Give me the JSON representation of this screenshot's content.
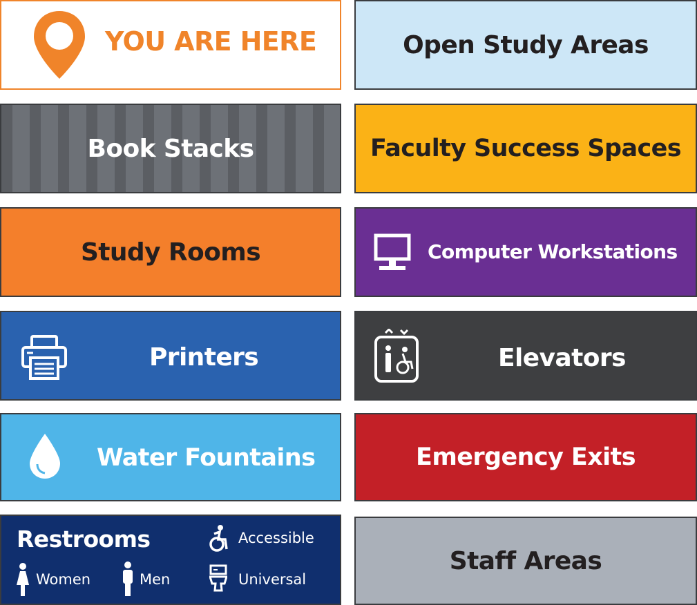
{
  "legend": {
    "you_are_here": {
      "label": "YOU ARE HERE",
      "icon": "location-pin-icon",
      "color": "#F0842A",
      "bg": "#ffffff"
    },
    "open_study_areas": {
      "label": "Open Study Areas",
      "color": "#CDE7F7"
    },
    "book_stacks": {
      "label": "Book Stacks",
      "color": "#5B5E63",
      "stripe_color": "#6D7177"
    },
    "faculty_success_spaces": {
      "label": "Faculty Success Spaces",
      "color": "#FBB216"
    },
    "study_rooms": {
      "label": "Study Rooms",
      "color": "#F47F2B"
    },
    "computer_workstations": {
      "label": "Computer Workstations",
      "icon": "monitor-icon",
      "color": "#6A2F93"
    },
    "printers": {
      "label": "Printers",
      "icon": "printer-icon",
      "color": "#2A62AF"
    },
    "elevators": {
      "label": "Elevators",
      "icon": "elevator-icon",
      "color": "#3E3F41"
    },
    "water_fountains": {
      "label": "Water Fountains",
      "icon": "water-drop-icon",
      "color": "#4FB5E8"
    },
    "emergency_exits": {
      "label": "Emergency Exits",
      "color": "#C32027"
    },
    "restrooms": {
      "title": "Restrooms",
      "women": "Women",
      "men": "Men",
      "accessible": "Accessible",
      "universal": "Universal",
      "color": "#102F6E"
    },
    "staff_areas": {
      "label": "Staff Areas",
      "color": "#AAB0B9"
    }
  }
}
